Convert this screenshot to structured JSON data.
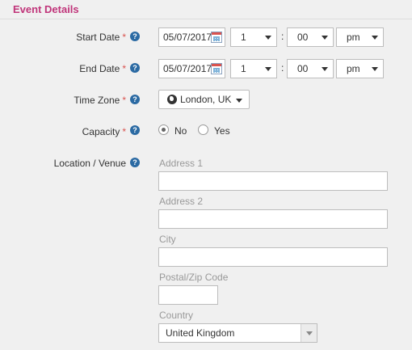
{
  "header": {
    "title": "Event Details"
  },
  "colors": {
    "accent": "#c0357a",
    "required": "#d9534f",
    "help": "#2b6aa3"
  },
  "required_marker": "*",
  "help_glyph": "?",
  "start": {
    "label": "Start Date",
    "date": "05/07/2017",
    "hour": "1",
    "minute": "00",
    "ampm": "pm"
  },
  "end": {
    "label": "End Date",
    "date": "05/07/2017",
    "hour": "1",
    "minute": "00",
    "ampm": "pm"
  },
  "time_separator": ":",
  "timezone": {
    "label": "Time Zone",
    "value": "London, UK"
  },
  "capacity": {
    "label": "Capacity",
    "options": [
      "No",
      "Yes"
    ],
    "selected": "No"
  },
  "location": {
    "label": "Location / Venue",
    "address1_label": "Address 1",
    "address1_value": "",
    "address2_label": "Address 2",
    "address2_value": "",
    "city_label": "City",
    "city_value": "",
    "postal_label": "Postal/Zip Code",
    "postal_value": "",
    "country_label": "Country",
    "country_value": "United Kingdom"
  }
}
